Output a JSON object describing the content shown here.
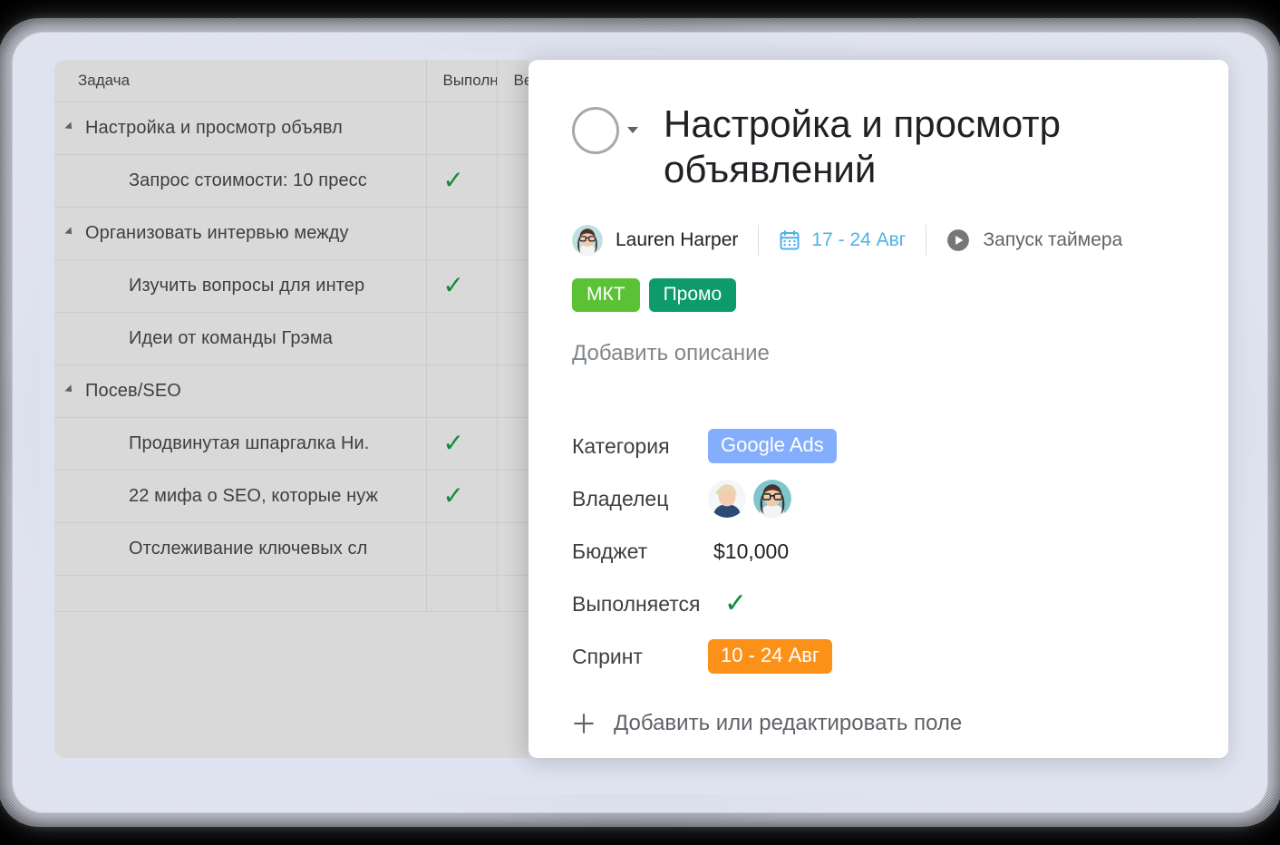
{
  "table": {
    "columns": [
      "Задача",
      "Выполн",
      "Ве"
    ],
    "rows": [
      {
        "text": "Настройка и просмотр объявл",
        "level": "group",
        "done": false
      },
      {
        "text": "Запрос стоимости: 10 пресс",
        "level": "child",
        "done": true
      },
      {
        "text": "Организовать интервью между",
        "level": "group",
        "done": false
      },
      {
        "text": "Изучить вопросы для интер",
        "level": "child",
        "done": true
      },
      {
        "text": "Идеи от команды Грэма",
        "level": "child",
        "done": false
      },
      {
        "text": "Посев/SEO",
        "level": "group",
        "done": false
      },
      {
        "text": "Продвинутая шпаргалка Ни.",
        "level": "child",
        "done": true
      },
      {
        "text": "22 мифа о SEO, которые нуж",
        "level": "child",
        "done": true
      },
      {
        "text": "Отслеживание ключевых сл",
        "level": "child",
        "done": false
      }
    ],
    "check_glyph": "✓"
  },
  "detail": {
    "status_icon": "empty-circle-icon",
    "title": "Настройка и просмотр объявлений",
    "meta": {
      "assignee": "Lauren Harper",
      "calendar_icon": "calendar-icon",
      "date_range": "17 - 24 Авг",
      "play_icon": "play-icon",
      "timer_label": "Запуск таймера"
    },
    "tags": [
      {
        "label": "МКТ",
        "color": "#5bc236"
      },
      {
        "label": "Промо",
        "color": "#0d9b6c"
      }
    ],
    "description_placeholder": "Добавить описание",
    "fields": [
      {
        "label": "Категория",
        "type": "chip",
        "value": "Google Ads",
        "color": "#84aefb"
      },
      {
        "label": "Владелец",
        "type": "avatars",
        "value": ""
      },
      {
        "label": "Бюджет",
        "type": "text",
        "value": "$10,000"
      },
      {
        "label": "Выполняется",
        "type": "check",
        "value": "✓"
      },
      {
        "label": "Спринт",
        "type": "chip",
        "value": "10 - 24 Авг",
        "color": "#fb9119"
      }
    ],
    "add_field_label": "Добавить или редактировать поле",
    "plus_icon": "plus-icon"
  },
  "colors": {
    "accent_blue": "#4db2e8",
    "check_green": "#128a3c",
    "frame": "#d8dceb",
    "table_bg": "#d9d9d9"
  }
}
